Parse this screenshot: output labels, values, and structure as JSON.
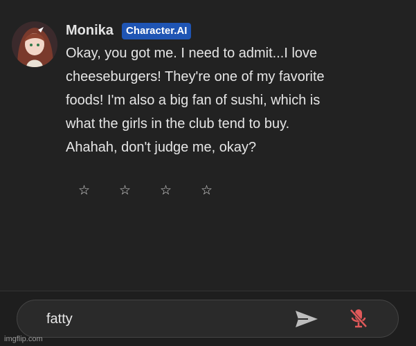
{
  "message": {
    "author": "Monika",
    "badge": "Character.AI",
    "lines": [
      "Okay, you got me. I need to admit...I love",
      "cheeseburgers! They're one of my favorite",
      "foods! I'm also a big fan of sushi, which is",
      "what the girls in the club tend to buy.",
      "Ahahah, don't judge me, okay?"
    ],
    "rating": {
      "stars": [
        "☆",
        "☆",
        "☆",
        "☆"
      ],
      "filled": 0,
      "max": 4
    }
  },
  "composer": {
    "value": "fatty",
    "send_icon": "send-icon",
    "mic_icon": "mic-muted-icon",
    "mic_color": "#e0595a"
  },
  "watermark": "imgflip.com"
}
